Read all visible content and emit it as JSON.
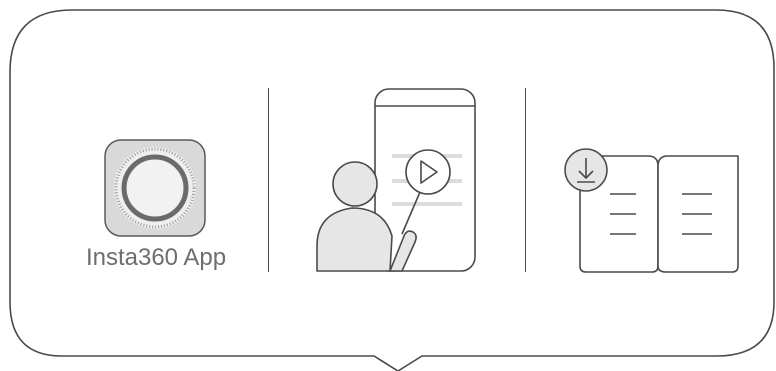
{
  "app": {
    "label": "Insta360 App",
    "icon": "insta360-app-icon"
  },
  "tutorial": {
    "icon": "video-tutorial-icon"
  },
  "manual": {
    "icon": "download-manual-icon"
  },
  "colors": {
    "outline": "#4a4a4a",
    "fill_light": "#e6e6e6",
    "app_tile": "#d9d9d9",
    "app_ring": "#6b6b6b"
  }
}
